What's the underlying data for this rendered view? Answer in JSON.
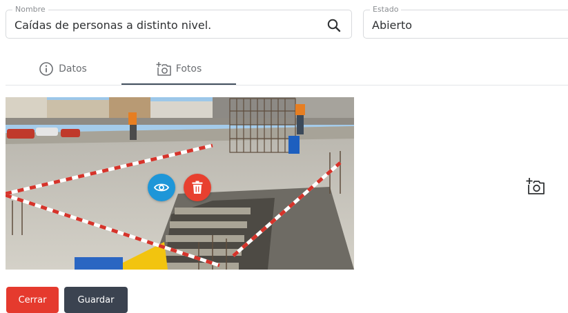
{
  "form": {
    "nombre": {
      "label": "Nombre",
      "value": "Caídas de personas a distinto nivel."
    },
    "estado": {
      "label": "Estado",
      "value": "Abierto"
    }
  },
  "tabs": [
    {
      "label": "Datos",
      "icon": "info-icon",
      "active": false
    },
    {
      "label": "Fotos",
      "icon": "add-photo-icon",
      "active": true
    }
  ],
  "photo": {
    "actions": {
      "view_icon": "eye-icon",
      "delete_icon": "trash-icon"
    }
  },
  "add_photo_icon": "add-photo-icon",
  "buttons": {
    "close_label": "Cerrar",
    "save_label": "Guardar"
  },
  "colors": {
    "view": "#1e96d8",
    "delete": "#e8402f",
    "close": "#e53a2e",
    "save": "#3b4350",
    "active_tab": "#424f5e"
  }
}
